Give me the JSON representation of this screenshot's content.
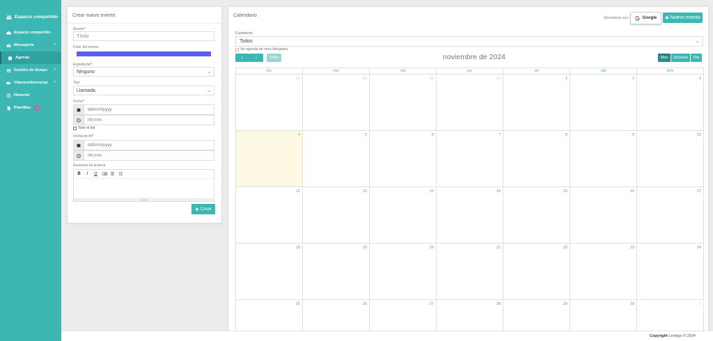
{
  "sidebar": {
    "brand": "Espacio compartido",
    "items": [
      {
        "label": "Espacio compartido",
        "icon": "cloud-icon",
        "chevron": ""
      },
      {
        "label": "Mensajería",
        "icon": "envelope-icon",
        "chevron": "‹"
      },
      {
        "label": "Agenda",
        "icon": "calendar-icon",
        "chevron": ""
      },
      {
        "label": "Gestión de tiempo",
        "icon": "list-icon",
        "chevron": "‹"
      },
      {
        "label": "Videoconferencias",
        "icon": "video-icon",
        "chevron": "‹"
      },
      {
        "label": "Historial",
        "icon": "history-icon",
        "chevron": ""
      },
      {
        "label": "Plantillas",
        "icon": "file-icon",
        "chevron": "",
        "badge": "1"
      }
    ]
  },
  "form": {
    "title": "Crear nuevo evento",
    "asunto_label": "Asunto",
    "asunto_placeholder": "Título",
    "color_label": "Color del evento",
    "color_value": "#5b5ee6",
    "expediente_label": "Expediente",
    "expediente_value": "Ninguno",
    "tipo_label": "Tipo",
    "tipo_value": "Llamada",
    "fecha_label": "Fecha",
    "date_placeholder": "dd/mm/yyyy",
    "time_placeholder": "hh:mm",
    "todo_el_dia": "Todo el día",
    "fecha_fin_label": "Fecha de fin",
    "resumen_label": "Resumen de la tarea",
    "toolbar": [
      "B",
      "I",
      "U",
      "⌫",
      "☰",
      "☷"
    ],
    "crear": "Crear",
    "required_mark": "*"
  },
  "calendar": {
    "title": "Calendario",
    "sync_label": "Sincronizar con:",
    "google": "Google",
    "nuevo_evento": "Nuevo evento",
    "expediente_label": "Expediente",
    "expediente_value": "Todos",
    "ver_agenda": "Ver agenda de otros Abogados",
    "prev": "‹",
    "next": "›",
    "hoy": "Today",
    "month": "noviembre de 2024",
    "views": [
      "Mes",
      "Semana",
      "Día"
    ],
    "dow": [
      "lun",
      "mar",
      "mié",
      "jue",
      "vie",
      "sáb",
      "dom"
    ],
    "weeks": [
      [
        "28",
        "29",
        "30",
        "31",
        "1",
        "2",
        "3"
      ],
      [
        "4",
        "5",
        "6",
        "7",
        "8",
        "9",
        "10"
      ],
      [
        "11",
        "12",
        "13",
        "14",
        "15",
        "16",
        "17"
      ],
      [
        "18",
        "19",
        "20",
        "21",
        "22",
        "23",
        "24"
      ],
      [
        "25",
        "26",
        "27",
        "28",
        "29",
        "30",
        "1"
      ]
    ]
  },
  "footer": {
    "copyright": "Copyright",
    "company": "Lexdigo © 2024"
  },
  "colors": {
    "accent": "#3cb7b4",
    "today": "#fcf8e3",
    "badge": "#e74c8c"
  }
}
